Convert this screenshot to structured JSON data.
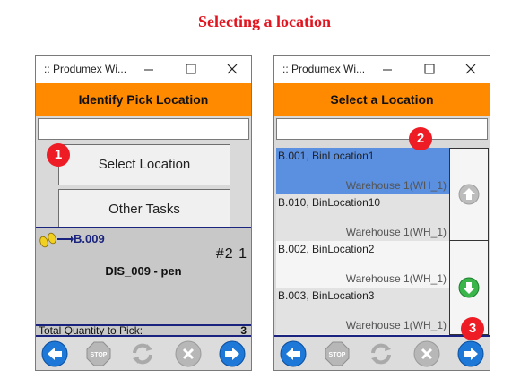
{
  "page_title": "Selecting a location",
  "left": {
    "window_title": ":: Produmex Wi...",
    "header": "Identify Pick Location",
    "search_value": "",
    "select_location_label": "Select Location",
    "other_tasks_label": "Other Tasks",
    "badge": "1",
    "location_code": "B.009",
    "counter": "#2 1",
    "item": "DIS_009 - pen",
    "total_label": "Total Quantity to Pick:",
    "total_value": "3"
  },
  "right": {
    "window_title": ":: Produmex Wi...",
    "header": "Select a Location",
    "search_value": "",
    "badge_search": "2",
    "badge_next": "3",
    "rows": [
      {
        "name": "B.001, BinLocation1",
        "warehouse": "Warehouse 1(WH_1)"
      },
      {
        "name": "B.010, BinLocation10",
        "warehouse": "Warehouse 1(WH_1)"
      },
      {
        "name": "B.002, BinLocation2",
        "warehouse": "Warehouse 1(WH_1)"
      },
      {
        "name": "B.003, BinLocation3",
        "warehouse": "Warehouse 1(WH_1)"
      }
    ]
  },
  "icons": {
    "back": "arrow-left-icon",
    "stop": "stop-icon",
    "refresh": "refresh-icon",
    "cancel": "x-icon",
    "next": "arrow-right-icon",
    "scroll_up": "arrow-up-icon",
    "scroll_down": "arrow-down-icon",
    "location_feet": "footprints-icon"
  },
  "colors": {
    "header": "#ff8a00",
    "selected_row": "#5b8fdf",
    "badge": "#ee1c24",
    "title": "#e2141f",
    "nav_blue": "#1e78d8"
  }
}
